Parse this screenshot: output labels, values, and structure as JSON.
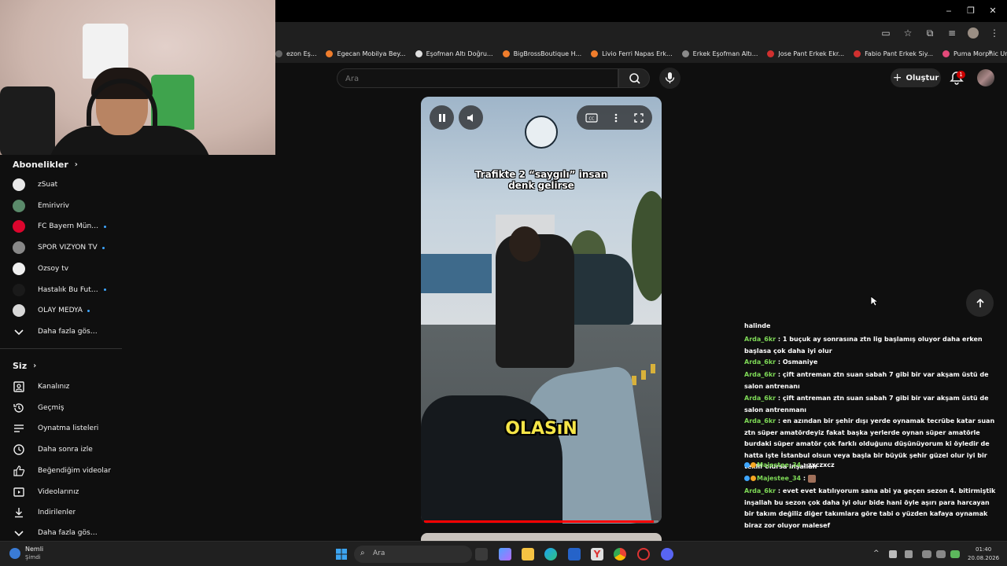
{
  "window": {
    "minimize": "‒",
    "maximize": "❐",
    "close": "✕"
  },
  "bookmarks": [
    {
      "label": "ezon Eş...",
      "color": "#666666"
    },
    {
      "label": "Egecan Mobilya Bey...",
      "color": "#f07d2c"
    },
    {
      "label": "Eşofman Altı Doğru...",
      "color": "#e0e0e0"
    },
    {
      "label": "BigBrossBoutique H...",
      "color": "#f07d2c"
    },
    {
      "label": "Livio Ferri Napas Erk...",
      "color": "#f07d2c"
    },
    {
      "label": "Erkek Eşofman Altı...",
      "color": "#8a8a8a"
    },
    {
      "label": "Jose Pant Erkek Ekr...",
      "color": "#d0302f"
    },
    {
      "label": "Fabio Pant Erkek Siy...",
      "color": "#d0302f"
    },
    {
      "label": "Puma Morphic Unis...",
      "color": "#e34a7a"
    }
  ],
  "bookmarks_more": "»",
  "masthead": {
    "search_placeholder": "Ara",
    "create_label": "Oluştur",
    "notification_count": "1"
  },
  "sidebar": {
    "subscriptions_title": "Abonelikler",
    "subscriptions": [
      {
        "label": "zSuat",
        "color": "#e8e8e8",
        "live": false
      },
      {
        "label": "Emirivriv",
        "color": "#5a8a6a",
        "live": false
      },
      {
        "label": "FC Bayern Münc...",
        "color": "#dc052d",
        "live": true
      },
      {
        "label": "SPOR VİZYON TV",
        "color": "#888888",
        "live": true
      },
      {
        "label": "Özsoy tv",
        "color": "#f0f0f0",
        "live": false
      },
      {
        "label": "Hastalık Bu Futbol",
        "color": "#1a1a1a",
        "live": true
      },
      {
        "label": "OLAY MEDYA",
        "color": "#d8d8d8",
        "live": true
      }
    ],
    "show_more_subs": "Daha fazla göster",
    "you_title": "Siz",
    "you_items": [
      {
        "label": "Kanalınız",
        "icon": "channel-icon"
      },
      {
        "label": "Geçmiş",
        "icon": "history-icon"
      },
      {
        "label": "Oynatma listeleri",
        "icon": "playlists-icon"
      },
      {
        "label": "Daha sonra izle",
        "icon": "watch-later-icon"
      },
      {
        "label": "Beğendiğim videolar",
        "icon": "like-icon"
      },
      {
        "label": "Videolarınız",
        "icon": "your-videos-icon"
      },
      {
        "label": "İndirilenler",
        "icon": "download-icon"
      }
    ],
    "show_more_you": "Daha fazla göster"
  },
  "video": {
    "caption_top_line1": "Trafikte 2 “saygılı” insan",
    "caption_top_line2": "denk gelirse",
    "caption_mid": "OLASıN",
    "progress": 0.98
  },
  "chat": [
    {
      "user": "",
      "text": "halinde"
    },
    {
      "user": "Arda_6kr",
      "text": "1 buçuk ay sonrasına ztn lig başlamış oluyor daha erken başlasa çok daha iyi olur"
    },
    {
      "user": "Arda_6kr",
      "text": "Osmaniye"
    },
    {
      "user": "Arda_6kr",
      "text": "çift antreman ztn suan sabah 7 gibi bir var akşam üstü de salon antrenanı"
    },
    {
      "user": "Arda_6kr",
      "text": "çift antreman ztn suan sabah 7 gibi bir var akşam üstü de salon antrenmanı"
    },
    {
      "user": "Arda_6kr",
      "text": "en azından bir şehir dışı yerde oynamak tecrübe katar suan ztn süper amatördeyiz fakat başka yerlerde oynan süper amatörle burdaki süper amatör çok farklı olduğunu düşünüyorum ki öyledir de hatta işte İstanbul olsun veya başla bir büyük şehir güzel olur iyi bir teklif olursa inşallah"
    },
    {
      "user": "Majestee_34",
      "text": "zxczxcz",
      "badges": true
    },
    {
      "user": "Majestee_34",
      "text": "",
      "badges": true,
      "emote": true
    },
    {
      "user": "Arda_6kr",
      "text": "evet evet katılıyorum sana abi ya geçen sezon 4. bitirmiştik inşallah bu sezon çok daha iyi olur bide hani öyle aşırı para harcayan bir takım değiliz diğer takımlara göre tabi o yüzden kafaya oynamak biraz zor oluyor malesef"
    }
  ],
  "taskbar": {
    "weather_label": "Nemli",
    "weather_sub": "Şimdi",
    "search_placeholder": "Ara",
    "time": "01:40",
    "date": "20.08.2026"
  }
}
